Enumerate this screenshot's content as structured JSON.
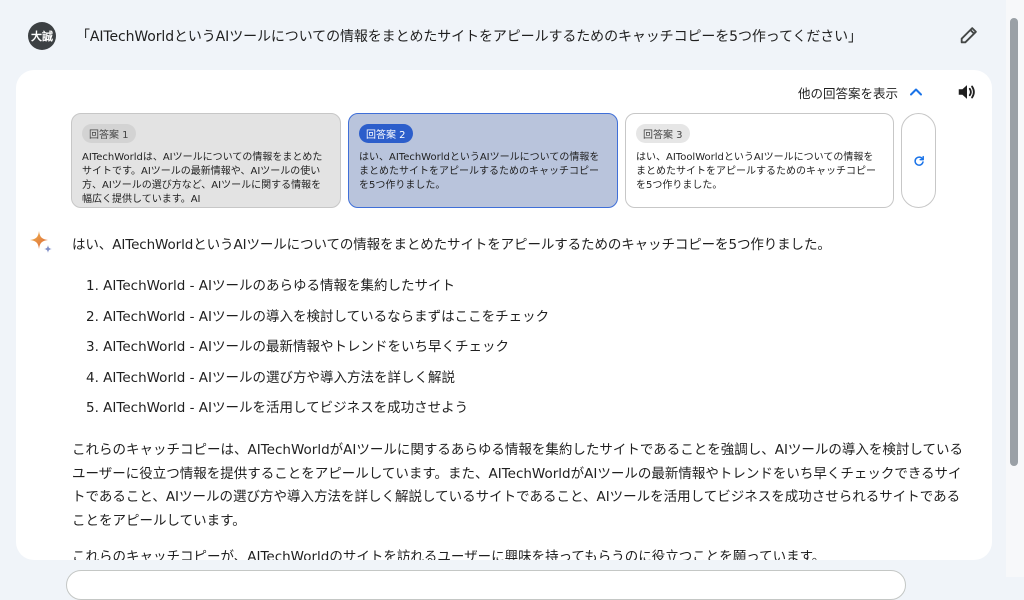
{
  "prompt": {
    "avatar_text": "大誠",
    "text": "「AITechWorldというAIツールについての情報をまとめたサイトをアピールするためのキャッチコピーを5つ作ってください」"
  },
  "drafts": {
    "toggle_label": "他の回答案を表示",
    "items": [
      {
        "badge": "回答案 1",
        "text": "AITechWorldは、AIツールについての情報をまとめたサイトです。AIツールの最新情報や、AIツールの使い方、AIツールの選び方など、AIツールに関する情報を幅広く提供しています。AI"
      },
      {
        "badge": "回答案 2",
        "text": "はい、AITechWorldというAIツールについての情報をまとめたサイトをアピールするためのキャッチコピーを5つ作りました。"
      },
      {
        "badge": "回答案 3",
        "text": "はい、AIToolWorldというAIツールについての情報をまとめたサイトをアピールするためのキャッチコピーを5つ作りました。"
      }
    ]
  },
  "answer": {
    "intro": "はい、AITechWorldというAIツールについての情報をまとめたサイトをアピールするためのキャッチコピーを5つ作りました。",
    "list": [
      "1. AITechWorld - AIツールのあらゆる情報を集約したサイト",
      "2. AITechWorld - AIツールの導入を検討しているならまずはここをチェック",
      "3. AITechWorld - AIツールの最新情報やトレンドをいち早くチェック",
      "4. AITechWorld - AIツールの選び方や導入方法を詳しく解説",
      "5. AITechWorld - AIツールを活用してビジネスを成功させよう"
    ],
    "paragraph": "これらのキャッチコピーは、AITechWorldがAIツールに関するあらゆる情報を集約したサイトであることを強調し、AIツールの導入を検討しているユーザーに役立つ情報を提供することをアピールしています。また、AITechWorldがAIツールの最新情報やトレンドをいち早くチェックできるサイトであること、AIツールの選び方や導入方法を詳しく解説しているサイトであること、AIツールを活用してビジネスを成功させられるサイトであることをアピールしています。",
    "cutoff": "これらのキャッチコピーが、AITechWorldのサイトを訪れるユーザーに興味を持ってもらうのに役立つことを願っています。"
  },
  "icons": {
    "edit": "pencil-icon",
    "toggle": "chevron-up-icon",
    "speaker": "speaker-icon",
    "regenerate": "refresh-icon",
    "assistant": "sparkle-icon"
  },
  "colors": {
    "accent": "#1a73e8",
    "selected_draft_bg": "#b9c4dc",
    "selected_badge": "#2c5ecb",
    "sparkle": "#e8a13a"
  }
}
